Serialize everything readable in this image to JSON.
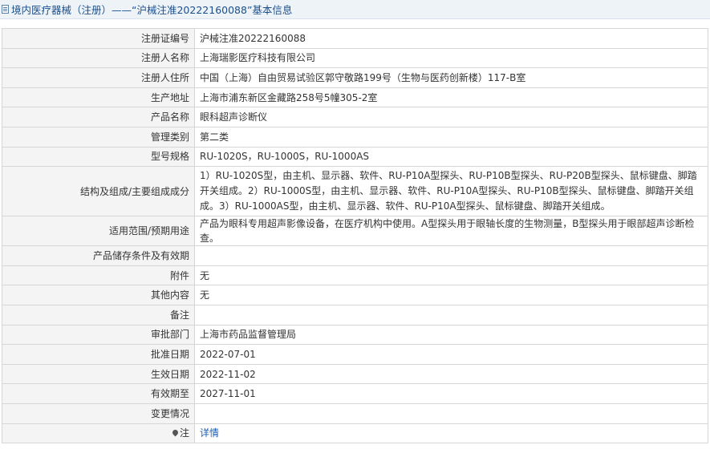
{
  "header": {
    "title": "境内医疗器械（注册）——“沪械注准20222160088”基本信息"
  },
  "rows": [
    {
      "label": "注册证编号",
      "value": "沪械注准20222160088"
    },
    {
      "label": "注册人名称",
      "value": "上海瑞影医疗科技有限公司"
    },
    {
      "label": "注册人住所",
      "value": "中国（上海）自由贸易试验区郭守敬路199号（生物与医药创新楼）117-B室"
    },
    {
      "label": "生产地址",
      "value": "上海市浦东新区金藏路258号5幢305-2室"
    },
    {
      "label": "产品名称",
      "value": "眼科超声诊断仪"
    },
    {
      "label": "管理类别",
      "value": "第二类"
    },
    {
      "label": "型号规格",
      "value": "RU-1020S，RU-1000S，RU-1000AS"
    },
    {
      "label": "结构及组成/主要组成成分",
      "value": "1）RU-1020S型，由主机、显示器、软件、RU-P10A型探头、RU-P10B型探头、RU-P20B型探头、鼠标键盘、脚踏开关组成。2）RU-1000S型，由主机、显示器、软件、RU-P10A型探头、RU-P10B型探头、鼠标键盘、脚踏开关组成。3）RU-1000AS型，由主机、显示器、软件、RU-P10A型探头、鼠标键盘、脚踏开关组成。"
    },
    {
      "label": "适用范围/预期用途",
      "value": "产品为眼科专用超声影像设备，在医疗机构中使用。A型探头用于眼轴长度的生物测量，B型探头用于眼部超声诊断检查。"
    },
    {
      "label": "产品储存条件及有效期",
      "value": ""
    },
    {
      "label": "附件",
      "value": "无"
    },
    {
      "label": "其他内容",
      "value": "无"
    },
    {
      "label": "备注",
      "value": ""
    },
    {
      "label": "审批部门",
      "value": "上海市药品监督管理局"
    },
    {
      "label": "批准日期",
      "value": "2022-07-01"
    },
    {
      "label": "生效日期",
      "value": "2022-11-02"
    },
    {
      "label": "有效期至",
      "value": "2027-11-01"
    },
    {
      "label": "变更情况",
      "value": ""
    }
  ],
  "note": {
    "label": "注",
    "link_text": "详情"
  }
}
